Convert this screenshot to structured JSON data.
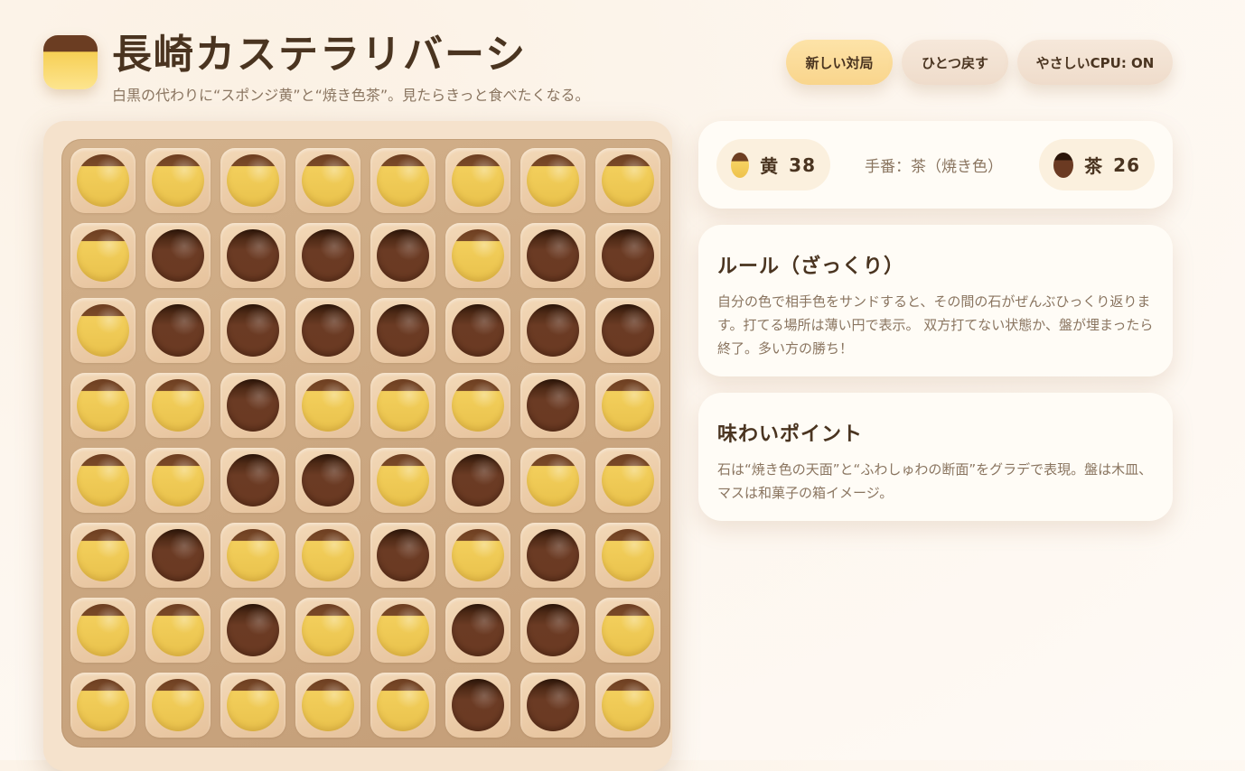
{
  "header": {
    "title": "長崎カステラリバーシ",
    "subtitle": "白黒の代わりに“スポンジ黄”と“焼き色茶”。見たらきっと食べたくなる。"
  },
  "toolbar": {
    "new_game_label": "新しい対局",
    "undo_label": "ひとつ戻す",
    "cpu_label": "やさしいCPU: ON"
  },
  "score": {
    "yellow": {
      "label": "黄",
      "count": "38"
    },
    "brown": {
      "label": "茶",
      "count": "26"
    },
    "turn_text": "手番：茶（焼き色）"
  },
  "rules": {
    "title": "ルール（ざっくり）",
    "body": "自分の色で相手色をサンドすると、その間の石がぜんぶひっくり返ります。打てる場所は薄い円で表示。 双方打てない状態か、盤が埋まったら終了。多い方の勝ち！"
  },
  "info": {
    "title": "味わいポイント",
    "body": "石は“焼き色の天面”と“ふわしゅわの断面”をグラデで表現。盤は木皿、マスは和菓子の箱イメージ。"
  },
  "board": {
    "rows": [
      [
        "Y",
        "Y",
        "Y",
        "Y",
        "Y",
        "Y",
        "Y",
        "Y"
      ],
      [
        "Y",
        "B",
        "B",
        "B",
        "B",
        "Y",
        "B",
        "B"
      ],
      [
        "Y",
        "B",
        "B",
        "B",
        "B",
        "B",
        "B",
        "B"
      ],
      [
        "Y",
        "Y",
        "B",
        "Y",
        "Y",
        "Y",
        "B",
        "Y"
      ],
      [
        "Y",
        "Y",
        "B",
        "B",
        "Y",
        "B",
        "Y",
        "Y"
      ],
      [
        "Y",
        "B",
        "Y",
        "Y",
        "B",
        "Y",
        "B",
        "Y"
      ],
      [
        "Y",
        "Y",
        "B",
        "Y",
        "Y",
        "B",
        "B",
        "Y"
      ],
      [
        "Y",
        "Y",
        "Y",
        "Y",
        "Y",
        "B",
        "B",
        "Y"
      ]
    ]
  },
  "colors": {
    "yellow": "#f3cf5c",
    "brown": "#6b3a22",
    "accent": "#f9d58c"
  }
}
